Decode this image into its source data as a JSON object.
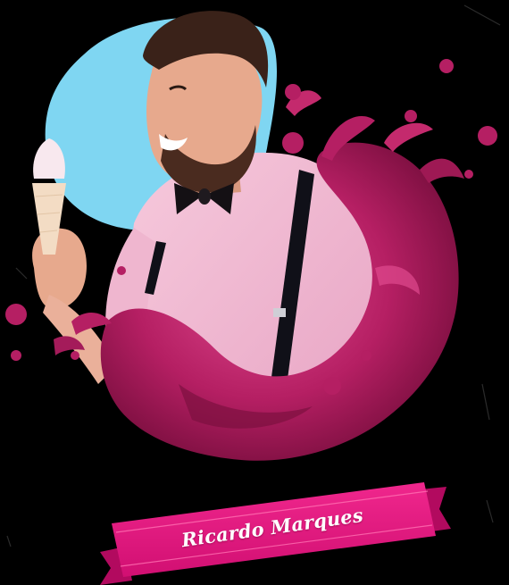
{
  "banner": {
    "name": "Ricardo Marques"
  },
  "colors": {
    "background": "#000000",
    "blob": "#7fd6f2",
    "splash_dark": "#7a0f3e",
    "splash": "#b51f63",
    "splash_light": "#e04a8f",
    "ribbon": "#e6157f",
    "ribbon_dark": "#b20a5f",
    "shirt": "#f2b8d3",
    "skin": "#e7a98d",
    "hair": "#3a2219",
    "bowtie": "#141014",
    "suspenders": "#101018"
  },
  "icons": {
    "portrait": "man-holding-ice-cream",
    "splash": "pink-liquid-splash",
    "ribbon": "name-ribbon-banner"
  }
}
